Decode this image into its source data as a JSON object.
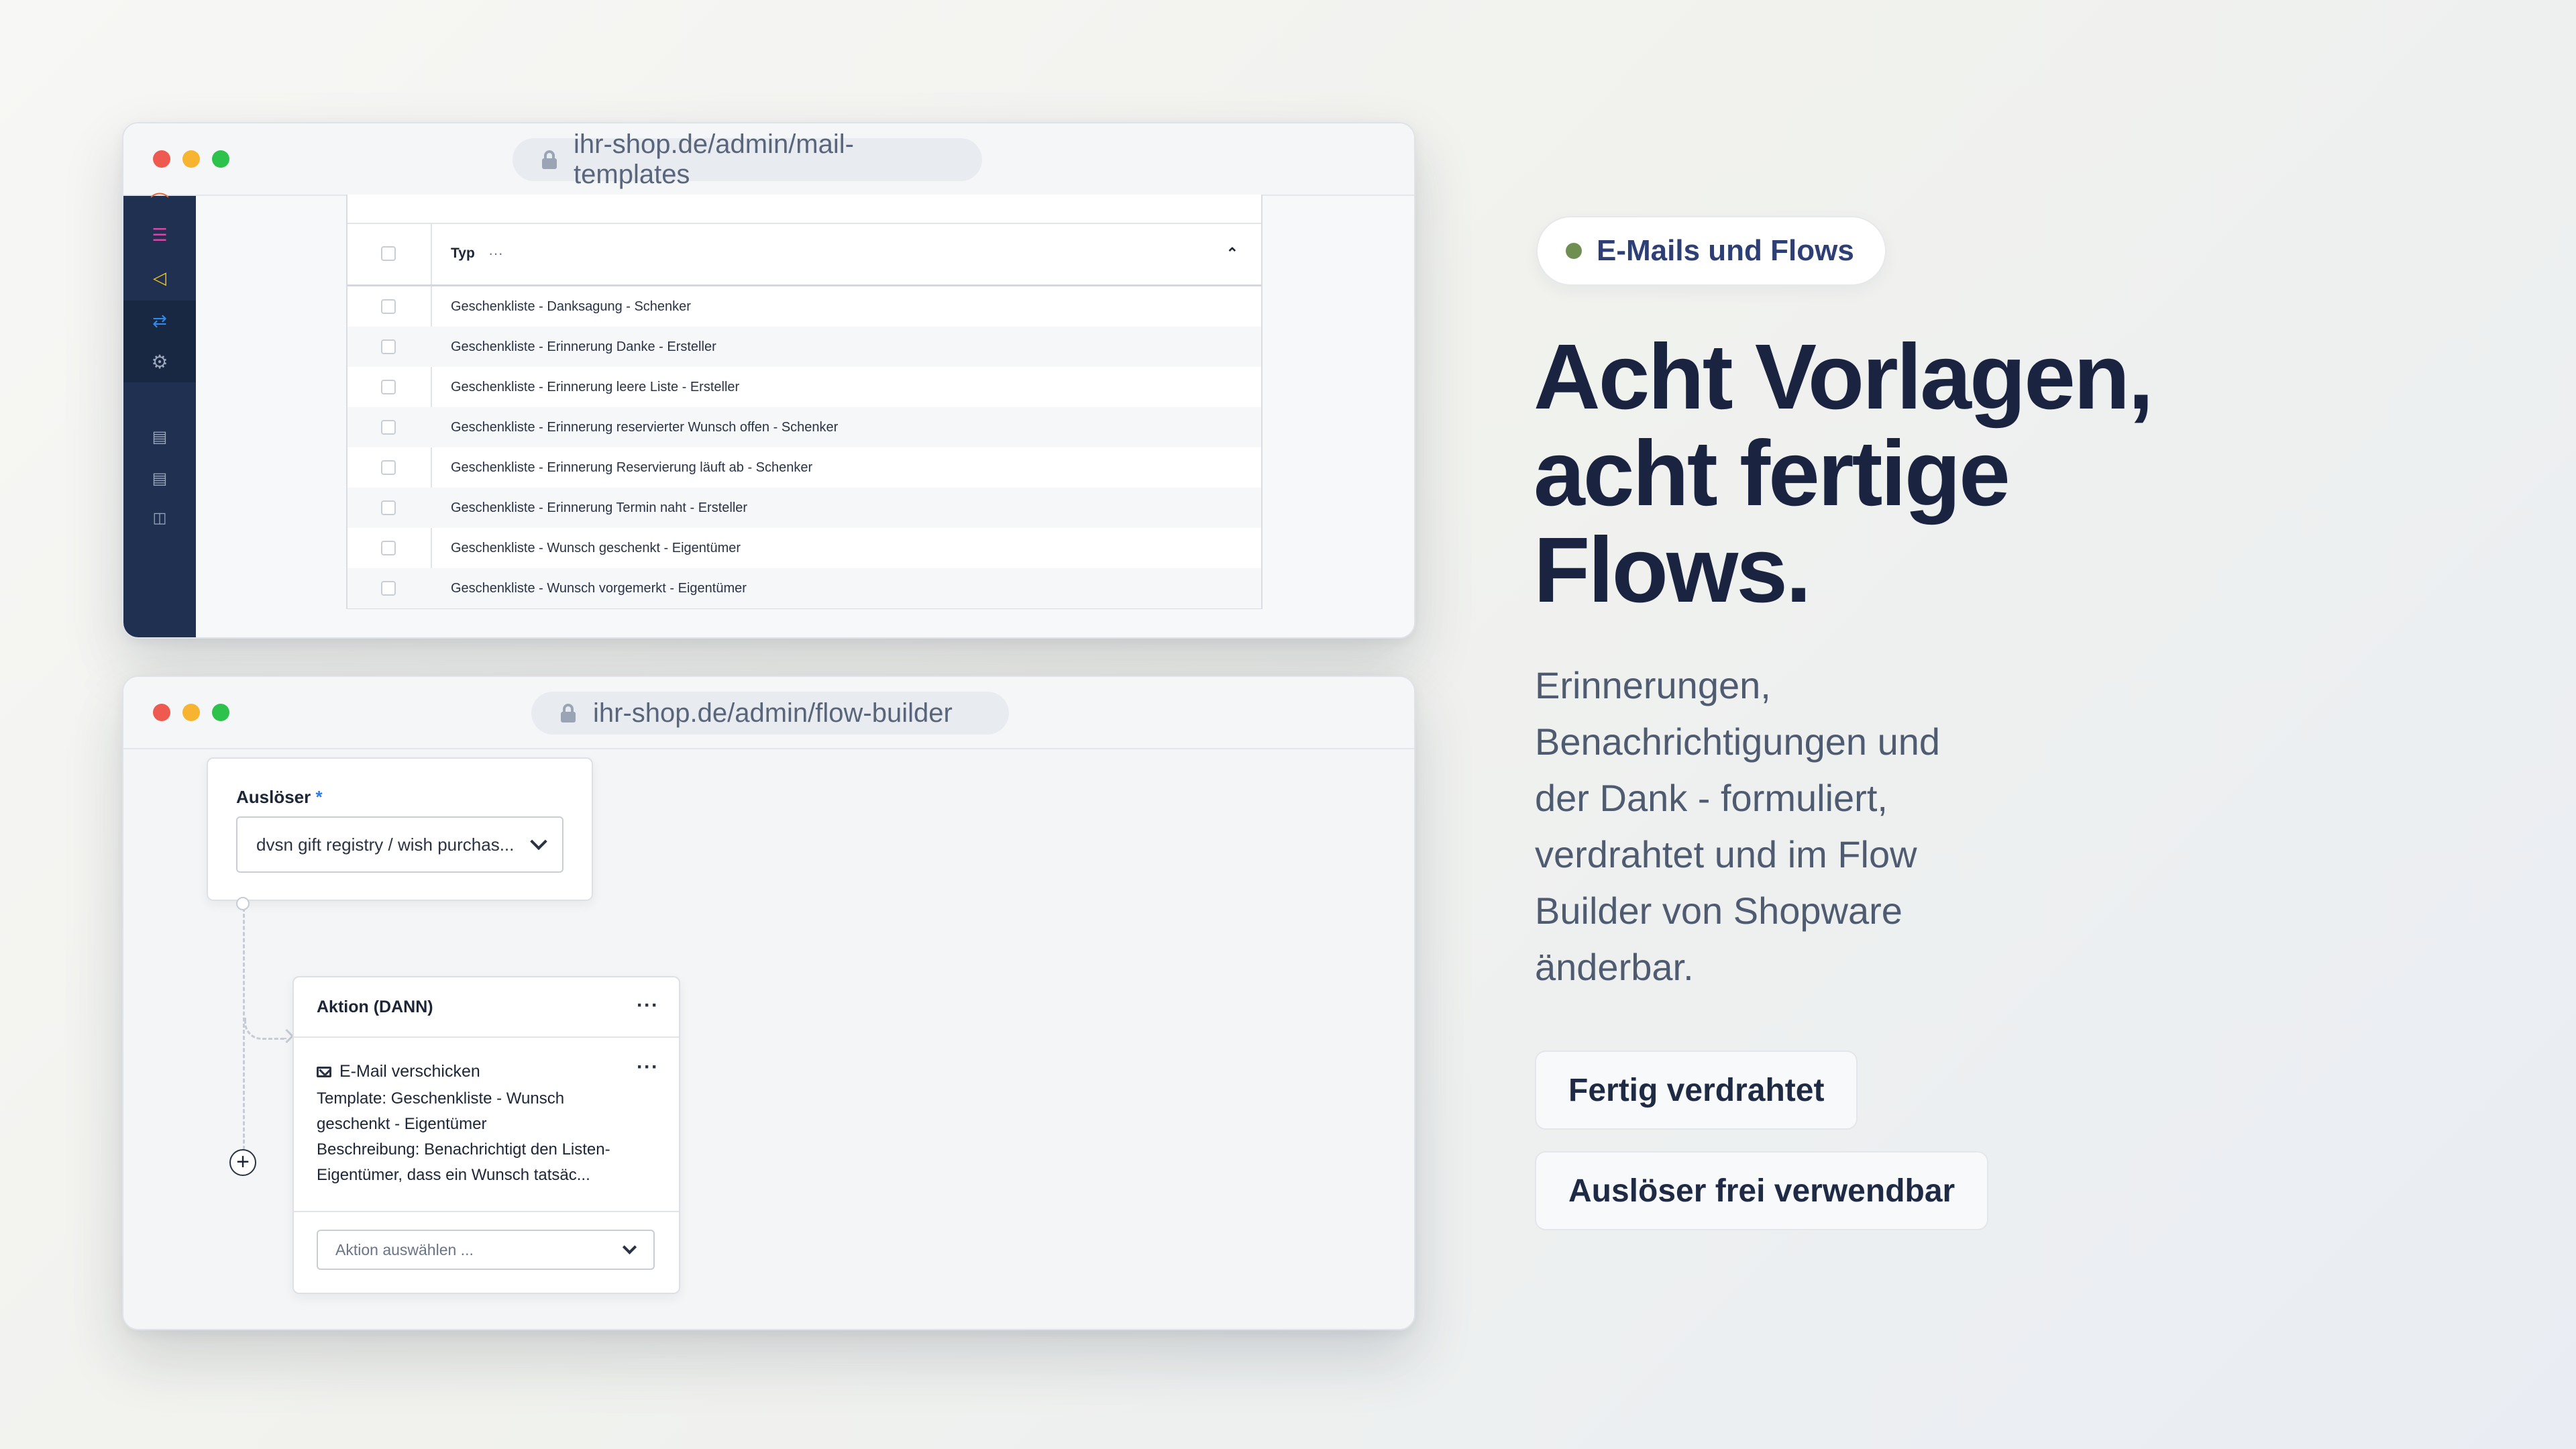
{
  "window_mail": {
    "url": "ihr-shop.de/admin/mail-templates",
    "sidebar_icons": [
      "users-icon",
      "list-icon",
      "megaphone-icon",
      "flow-icon",
      "gear-icon",
      "store-icon",
      "store-icon",
      "basket-icon"
    ],
    "table": {
      "column_header": "Typ",
      "header_more": "···",
      "rows": [
        "Geschenkliste - Danksagung - Schenker",
        "Geschenkliste - Erinnerung Danke - Ersteller",
        "Geschenkliste - Erinnerung leere Liste - Ersteller",
        "Geschenkliste - Erinnerung reservierter Wunsch offen - Schenker",
        "Geschenkliste - Erinnerung Reservierung läuft ab - Schenker",
        "Geschenkliste - Erinnerung Termin naht - Ersteller",
        "Geschenkliste - Wunsch geschenkt - Eigentümer",
        "Geschenkliste - Wunsch vorgemerkt - Eigentümer"
      ]
    }
  },
  "window_flow": {
    "url": "ihr-shop.de/admin/flow-builder",
    "trigger": {
      "label": "Auslöser",
      "required_mark": "*",
      "value": "dvsn gift registry / wish purchas..."
    },
    "action": {
      "title": "Aktion (DANN)",
      "more": "···",
      "mail_label": "E-Mail verschicken",
      "desc_line1": "Template: Geschenkliste - Wunsch",
      "desc_line2": "geschenkt - Eigentümer",
      "desc_line3": "Beschreibung: Benachrichtigt den Listen-",
      "desc_line4": "Eigentümer, dass ein Wunsch tatsäc...",
      "select_placeholder": "Aktion auswählen ...",
      "add_symbol": "+"
    }
  },
  "hero": {
    "badge": "E-Mails und Flows",
    "headline_line1": "Acht Vorlagen,",
    "headline_line2": "acht fertige",
    "headline_line3": "Flows.",
    "lead_line1": "Erinnerungen,",
    "lead_line2": "Benachrichtigungen und",
    "lead_line3": "der Dank - formuliert,",
    "lead_line4": "verdrahtet und im Flow",
    "lead_line5": "Builder von Shopware",
    "lead_line6": "änderbar.",
    "button1": "Fertig verdrahtet",
    "button2": "Auslöser frei verwendbar"
  },
  "colors": {
    "headline": "#1a2440",
    "badge_text": "#2e3f75",
    "badge_dot": "#6f8f52",
    "sidebar_bg": "#1f3050",
    "accent_blue": "#2b7de6"
  }
}
